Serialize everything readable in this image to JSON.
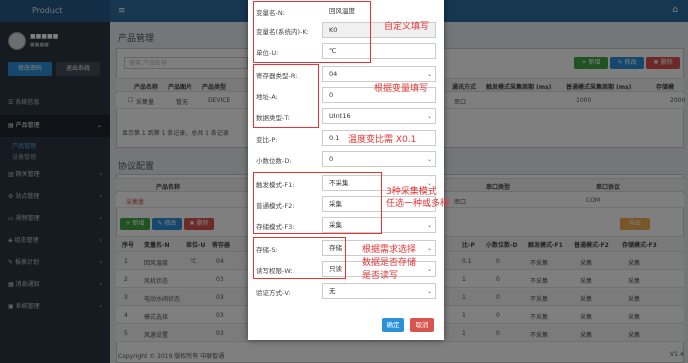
{
  "topbar": {
    "menu_icon": "≡",
    "home_icon": "⌂"
  },
  "sidebar": {
    "buttons": [
      "修改密码",
      "退出系统"
    ],
    "items": [
      {
        "label": "系统信息",
        "icon": "☰"
      },
      {
        "label": "产品管理",
        "icon": "▤",
        "active": true
      },
      {
        "label": "网关管理",
        "icon": "▥"
      },
      {
        "label": "站点管理",
        "icon": "⚙"
      },
      {
        "label": "视频管理",
        "icon": "▭"
      },
      {
        "label": "组态管理",
        "icon": "◈"
      },
      {
        "label": "报表计划",
        "icon": "✎"
      },
      {
        "label": "消息通知",
        "icon": "▦"
      },
      {
        "label": "系统管理",
        "icon": "▣"
      }
    ],
    "subitems": [
      "产品管理",
      "设备管理"
    ]
  },
  "main": {
    "title": "产品管理",
    "search_placeholder": "搜索 产品名称",
    "toolbar": {
      "add": "+ 新增",
      "edit": "✎ 修改",
      "delete": "✖ 删除"
    },
    "product_table": {
      "headers": [
        "产品名称",
        "产品图片",
        "产品类型",
        "通讯方式",
        "触发模式采集周期 (ms)",
        "普通模式采集周期 (ms)",
        "存储模"
      ],
      "row": [
        "采集量",
        "暂无",
        "DEVICE",
        "串口",
        "1000",
        "2000"
      ]
    },
    "pagination": "显示第 1 到第 1 条记录，总共 1 条记录",
    "config_title": "协议配置",
    "config_headers": [
      "产品名称",
      "串口类型",
      "串口协议"
    ],
    "config_row": [
      "采集量",
      "串口",
      "COM"
    ],
    "config_toolbar": {
      "add": "+ 新增",
      "edit": "✎ 修改",
      "delete": "✖ 删除",
      "export": "导出"
    },
    "var_headers": [
      "序号",
      "变量名-N",
      "单位-U",
      "寄存器",
      "比-P",
      "小数位数-D",
      "触发模式-F1",
      "普通模式-F2",
      "存储模式-F3"
    ],
    "var_rows": [
      {
        "no": "1",
        "name": "回风温度",
        "unit": "℃",
        "reg": "04",
        "ratio": "0.1",
        "dec": "0",
        "f1": "不采集",
        "f2": "采集",
        "f3": "采集"
      },
      {
        "no": "2",
        "name": "风机状态",
        "unit": "",
        "reg": "03",
        "ratio": "1",
        "dec": "0",
        "f1": "不采集",
        "f2": "采集",
        "f3": "采集"
      },
      {
        "no": "3",
        "name": "电动水阀状态",
        "unit": "",
        "reg": "03",
        "ratio": "1",
        "dec": "0",
        "f1": "不采集",
        "f2": "采集",
        "f3": "采集"
      },
      {
        "no": "4",
        "name": "模式选择",
        "unit": "",
        "reg": "03",
        "ratio": "1",
        "dec": "0",
        "f1": "不采集",
        "f2": "采集",
        "f3": "采集"
      },
      {
        "no": "5",
        "name": "风速设置",
        "unit": "",
        "reg": "03",
        "ratio": "1",
        "dec": "0",
        "f1": "不采集",
        "f2": "采集",
        "f3": "采集"
      }
    ],
    "footer": "Copyright © 2019 版权所有 中联智通",
    "version": "V1.4"
  },
  "modal": {
    "fields": [
      {
        "label": "变量名-N:",
        "value": "回风温度",
        "type": "text"
      },
      {
        "label": "变量名(系统内)-K:",
        "value": "K0",
        "type": "readonly"
      },
      {
        "label": "单位-U:",
        "value": "℃",
        "type": "text"
      },
      {
        "label": "寄存器类型-R:",
        "value": "04",
        "type": "select"
      },
      {
        "label": "地址-A:",
        "value": "0",
        "type": "text"
      },
      {
        "label": "数据类型-T:",
        "value": "UInt16",
        "type": "select"
      },
      {
        "label": "变比-P:",
        "value": "0.1",
        "type": "text"
      },
      {
        "label": "小数位数-D:",
        "value": "0",
        "type": "select"
      },
      {
        "label": "触发模式-F1:",
        "value": "不采集",
        "type": "select"
      },
      {
        "label": "普通模式-F2:",
        "value": "采集",
        "type": "select"
      },
      {
        "label": "存储模式-F3:",
        "value": "采集",
        "type": "select"
      },
      {
        "label": "存储-S:",
        "value": "存储",
        "type": "select"
      },
      {
        "label": "读写权限-W:",
        "value": "只读",
        "type": "select"
      },
      {
        "label": "验证方式-V:",
        "value": "无",
        "type": "select"
      }
    ],
    "confirm": "确定",
    "cancel": "取消"
  },
  "annotations": {
    "custom": "自定义填写",
    "by_var": "根据变量填写",
    "ratio": "温度变比需 X0.1",
    "modes": [
      "3种采集模式",
      "任选一种或多种"
    ],
    "storage": [
      "根据需求选择",
      "数据是否存储",
      "是否读写"
    ]
  },
  "colors": {
    "annotation": "#e63434",
    "primary": "#2a91d8",
    "success": "#43a443",
    "danger": "#d9534f"
  }
}
